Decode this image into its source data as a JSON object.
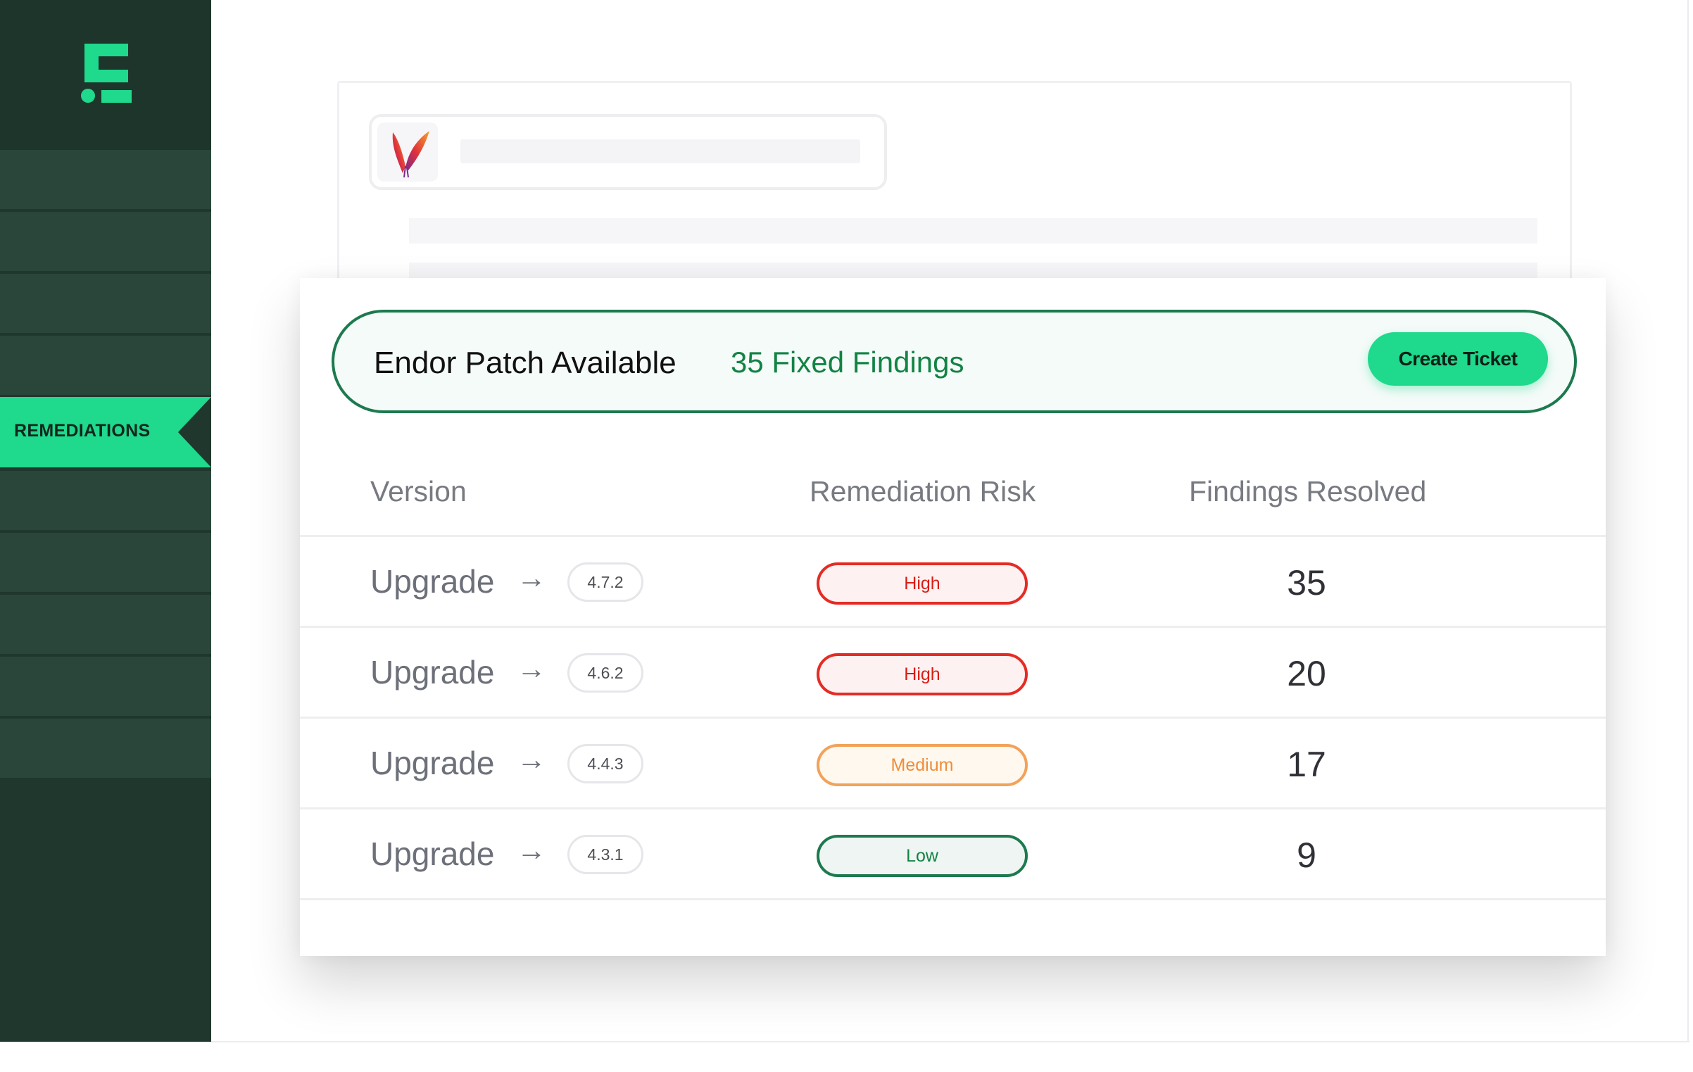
{
  "sidebar": {
    "active_label": "REMEDIATIONS"
  },
  "patch_banner": {
    "title": "Endor Patch Available",
    "fixed_findings": "35 Fixed Findings",
    "create_ticket_label": "Create Ticket"
  },
  "table": {
    "headers": {
      "version": "Version",
      "risk": "Remediation Risk",
      "findings": "Findings Resolved"
    },
    "rows": [
      {
        "action": "Upgrade",
        "version": "4.7.2",
        "risk": "High",
        "findings": "35"
      },
      {
        "action": "Upgrade",
        "version": "4.6.2",
        "risk": "High",
        "findings": "20"
      },
      {
        "action": "Upgrade",
        "version": "4.4.3",
        "risk": "Medium",
        "findings": "17"
      },
      {
        "action": "Upgrade",
        "version": "4.3.1",
        "risk": "Low",
        "findings": "9"
      }
    ]
  },
  "colors": {
    "brand_green": "#1fd98c",
    "sidebar_bg": "#20372e",
    "risk_high": "#e42c25",
    "risk_medium": "#f2a25a",
    "risk_low": "#1c7a4e"
  },
  "icons": {
    "logo": "endor-logo-icon",
    "package": "feather-icon",
    "arrow": "arrow-right-icon"
  }
}
